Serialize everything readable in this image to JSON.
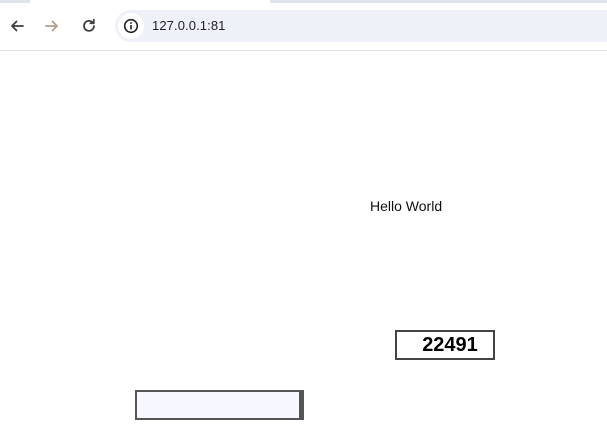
{
  "browser": {
    "url": "127.0.0.1:81"
  },
  "page": {
    "greeting": "Hello World",
    "counter_value": "22491",
    "input_value": ""
  }
}
